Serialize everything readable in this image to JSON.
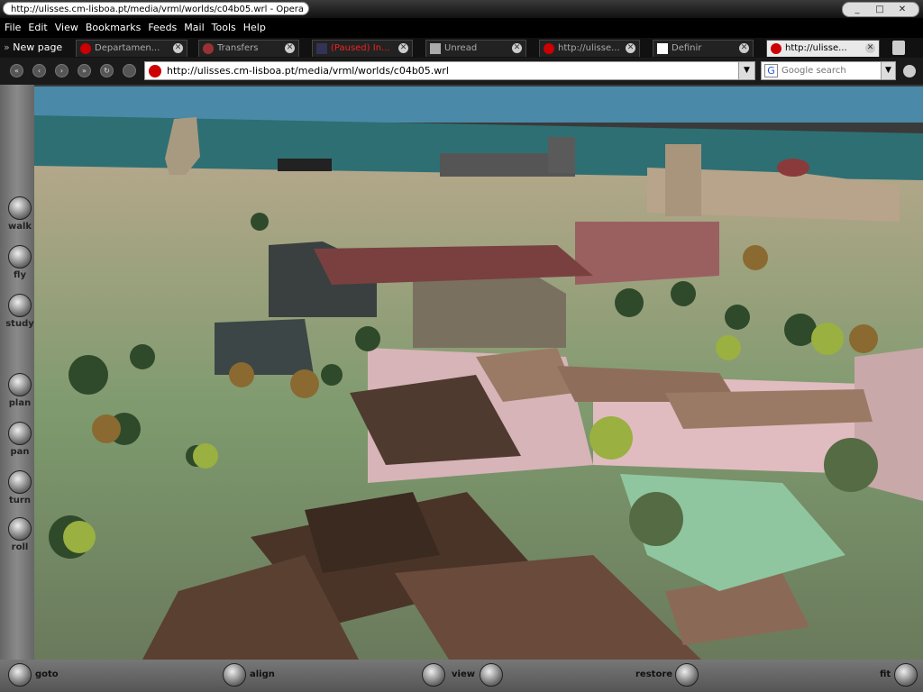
{
  "window": {
    "title": "http://ulisses.cm-lisboa.pt/media/vrml/worlds/c04b05.wrl - Opera"
  },
  "menu": [
    "File",
    "Edit",
    "View",
    "Bookmarks",
    "Feeds",
    "Mail",
    "Tools",
    "Help"
  ],
  "tabs": {
    "new_page": "New page",
    "items": [
      {
        "label": "Departamen...",
        "active": false,
        "icon": "opera-icon"
      },
      {
        "label": "Transfers",
        "active": false,
        "icon": "transfers-icon"
      },
      {
        "label": "(Paused) In...",
        "active": false,
        "icon": "p-icon"
      },
      {
        "label": "Unread",
        "active": false,
        "icon": "mail-icon"
      },
      {
        "label": "http://ulisse...",
        "active": false,
        "icon": "opera-icon"
      },
      {
        "label": "Definir",
        "active": false,
        "icon": "figure-icon"
      },
      {
        "label": "http://ulisse...",
        "active": true,
        "icon": "opera-icon"
      }
    ]
  },
  "address": {
    "url": "http://ulisses.cm-lisboa.pt/media/vrml/worlds/c04b05.wrl"
  },
  "search": {
    "placeholder": "Google search"
  },
  "vrml": {
    "left_controls": [
      "walk",
      "fly",
      "study",
      "plan",
      "pan",
      "turn",
      "roll"
    ],
    "bottom_controls": {
      "goto": "goto",
      "align": "align",
      "view": "view",
      "restore": "restore",
      "fit": "fit"
    }
  },
  "colors": {
    "sky": "#2e6f73",
    "ground": "#8a9a78",
    "roof": "#7a5a48"
  }
}
